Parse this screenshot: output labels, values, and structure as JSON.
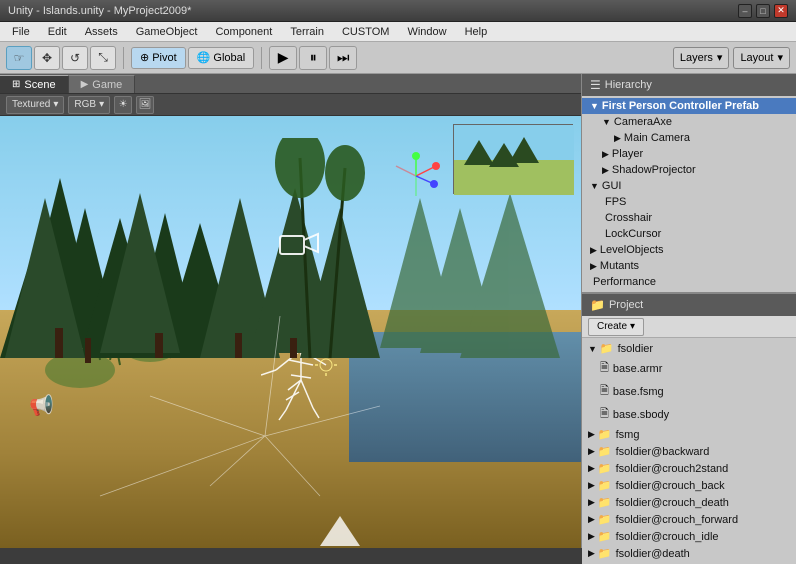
{
  "titleBar": {
    "title": "Unity - Islands.unity - MyProject2009*",
    "minimize": "–",
    "maximize": "□",
    "close": "✕"
  },
  "menuBar": {
    "items": [
      "File",
      "Edit",
      "Assets",
      "GameObject",
      "Component",
      "Terrain",
      "CUSTOM",
      "Window",
      "Help"
    ]
  },
  "toolbar": {
    "tools": [
      {
        "name": "eye",
        "symbol": "👁",
        "label": "hand-tool"
      },
      {
        "name": "move",
        "symbol": "✥",
        "label": "move-tool"
      },
      {
        "name": "rotate",
        "symbol": "↺",
        "label": "rotate-tool"
      },
      {
        "name": "scale",
        "symbol": "⤡",
        "label": "scale-tool"
      }
    ],
    "pivot": "Pivot",
    "global": "Global",
    "play": "▶",
    "pause": "⏸",
    "step": "⏭",
    "layers": "Layers",
    "layout": "Layout"
  },
  "sceneToolbar": {
    "shading": "Textured",
    "channel": "RGB"
  },
  "hierarchy": {
    "title": "Hierarchy",
    "items": [
      {
        "label": "First Person Controller Prefab",
        "level": 0,
        "expanded": true,
        "selected": true
      },
      {
        "label": "CameraAxe",
        "level": 1,
        "expanded": true
      },
      {
        "label": "Main Camera",
        "level": 2,
        "expanded": false
      },
      {
        "label": "Player",
        "level": 1,
        "expanded": false
      },
      {
        "label": "ShadowProjector",
        "level": 1,
        "expanded": false
      },
      {
        "label": "GUI",
        "level": 0,
        "expanded": true
      },
      {
        "label": "FPS",
        "level": 1,
        "expanded": false
      },
      {
        "label": "Crosshair",
        "level": 1,
        "expanded": false
      },
      {
        "label": "LockCursor",
        "level": 1,
        "expanded": false
      },
      {
        "label": "LevelObjects",
        "level": 0,
        "expanded": false
      },
      {
        "label": "Mutants",
        "level": 0,
        "expanded": false
      },
      {
        "label": "Performance",
        "level": 0,
        "expanded": false
      }
    ]
  },
  "project": {
    "title": "Project",
    "createLabel": "Create",
    "items": [
      {
        "label": "fsoldier",
        "level": 0,
        "type": "folder",
        "expanded": true
      },
      {
        "label": "base.armr",
        "level": 1,
        "type": "file"
      },
      {
        "label": "base.fsmg",
        "level": 1,
        "type": "file"
      },
      {
        "label": "base.sbody",
        "level": 1,
        "type": "file"
      },
      {
        "label": "fsmg",
        "level": 0,
        "type": "folder",
        "expanded": false
      },
      {
        "label": "fsoldier@backward",
        "level": 0,
        "type": "folder",
        "expanded": false
      },
      {
        "label": "fsoldier@crouch2stand",
        "level": 0,
        "type": "folder",
        "expanded": false
      },
      {
        "label": "fsoldier@crouch_back",
        "level": 0,
        "type": "folder",
        "expanded": false
      },
      {
        "label": "fsoldier@crouch_death",
        "level": 0,
        "type": "folder",
        "expanded": false
      },
      {
        "label": "fsoldier@crouch_forward",
        "level": 0,
        "type": "folder",
        "expanded": false
      },
      {
        "label": "fsoldier@crouch_idle",
        "level": 0,
        "type": "folder",
        "expanded": false
      },
      {
        "label": "fsoldier@death",
        "level": 0,
        "type": "folder",
        "expanded": false
      }
    ]
  }
}
